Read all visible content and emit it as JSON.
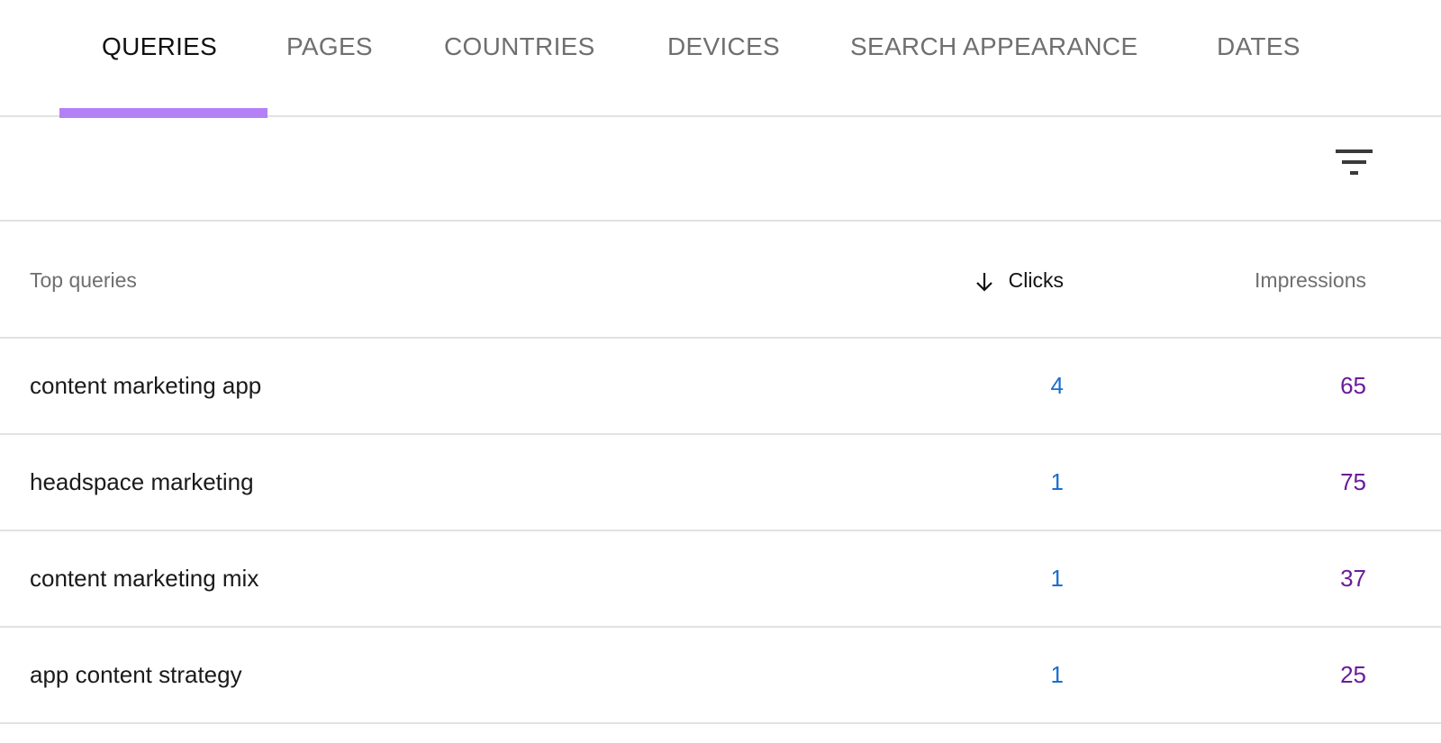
{
  "tabs": [
    {
      "label": "QUERIES",
      "active": true
    },
    {
      "label": "PAGES"
    },
    {
      "label": "COUNTRIES"
    },
    {
      "label": "DEVICES"
    },
    {
      "label": "SEARCH APPEARANCE"
    },
    {
      "label": "DATES"
    }
  ],
  "colors": {
    "tab_indicator": "#b381f5",
    "clicks": "#1a6fd0",
    "impressions": "#6a1b9a"
  },
  "toolbar": {
    "filter_icon": "filter-icon"
  },
  "table": {
    "headers": {
      "query": "Top queries",
      "clicks": "Clicks",
      "impressions": "Impressions",
      "sort": "descending-by-clicks"
    },
    "rows": [
      {
        "query": "content marketing app",
        "clicks": "4",
        "impressions": "65"
      },
      {
        "query": "headspace marketing",
        "clicks": "1",
        "impressions": "75"
      },
      {
        "query": "content marketing mix",
        "clicks": "1",
        "impressions": "37"
      },
      {
        "query": "app content strategy",
        "clicks": "1",
        "impressions": "25"
      }
    ]
  }
}
